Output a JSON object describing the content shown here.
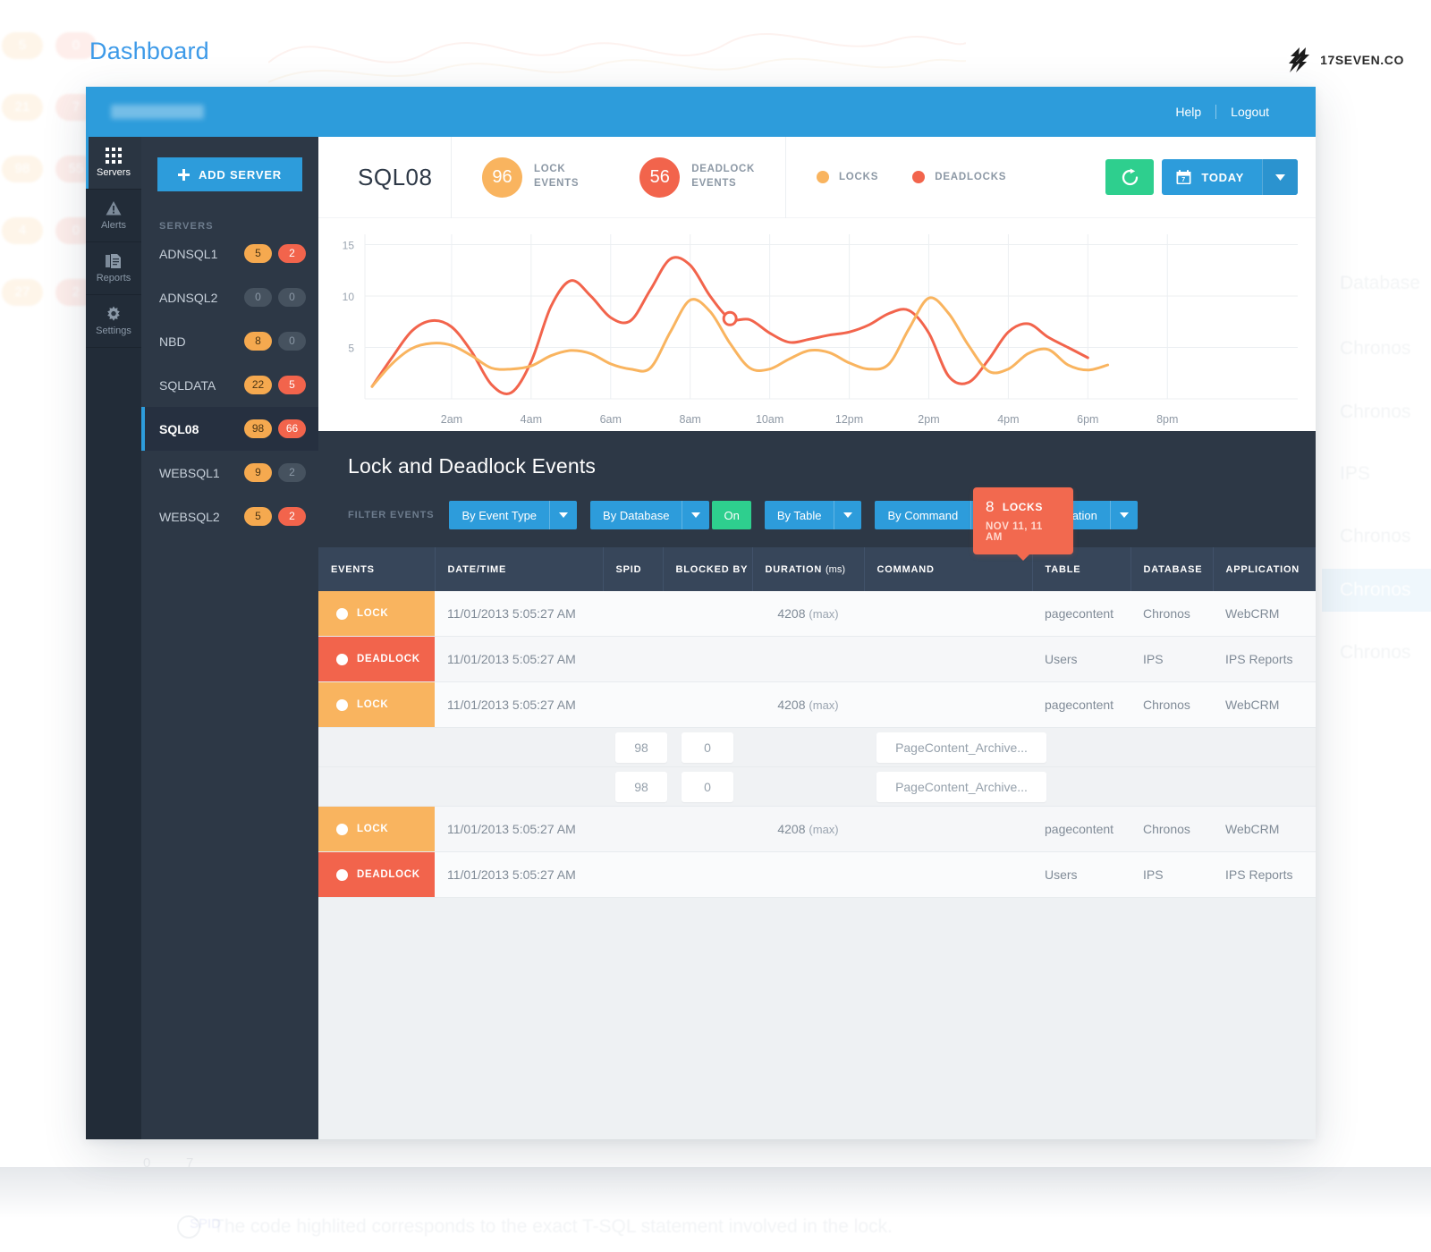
{
  "page": {
    "title": "Dashboard",
    "brand_name": "17SEVEN.CO"
  },
  "topbar": {
    "help_label": "Help",
    "logout_label": "Logout"
  },
  "rail": {
    "items": [
      {
        "label": "Servers",
        "icon": "grid-icon",
        "active": true
      },
      {
        "label": "Alerts",
        "icon": "warning-icon",
        "active": false
      },
      {
        "label": "Reports",
        "icon": "document-icon",
        "active": false
      },
      {
        "label": "Settings",
        "icon": "gear-icon",
        "active": false
      }
    ]
  },
  "sidebar": {
    "add_server_label": "ADD SERVER",
    "section_heading": "SERVERS",
    "servers": [
      {
        "name": "ADNSQL1",
        "locks": "5",
        "locks_style": "amber",
        "deadlocks": "2",
        "deadlocks_style": "red",
        "active": false
      },
      {
        "name": "ADNSQL2",
        "locks": "0",
        "locks_style": "muted",
        "deadlocks": "0",
        "deadlocks_style": "muted",
        "active": false
      },
      {
        "name": "NBD",
        "locks": "8",
        "locks_style": "amber",
        "deadlocks": "0",
        "deadlocks_style": "muted",
        "active": false
      },
      {
        "name": "SQLDATA",
        "locks": "22",
        "locks_style": "amber",
        "deadlocks": "5",
        "deadlocks_style": "red",
        "active": false
      },
      {
        "name": "SQL08",
        "locks": "98",
        "locks_style": "amber",
        "deadlocks": "66",
        "deadlocks_style": "red",
        "active": true
      },
      {
        "name": "WEBSQL1",
        "locks": "9",
        "locks_style": "amber",
        "deadlocks": "2",
        "deadlocks_style": "muted",
        "active": false
      },
      {
        "name": "WEBSQL2",
        "locks": "5",
        "locks_style": "amber",
        "deadlocks": "2",
        "deadlocks_style": "red",
        "active": false
      }
    ]
  },
  "header": {
    "server_name": "SQL08",
    "metrics": [
      {
        "value": "96",
        "label_line1": "LOCK",
        "label_line2": "EVENTS",
        "color": "#f9b45f"
      },
      {
        "value": "56",
        "label_line1": "DEADLOCK",
        "label_line2": "EVENTS",
        "color": "#f2644c"
      }
    ],
    "legend": [
      {
        "label": "LOCKS",
        "color": "#f9b45f"
      },
      {
        "label": "DEADLOCKS",
        "color": "#f2644c"
      }
    ],
    "refresh_icon": "refresh-icon",
    "date_icon": "calendar-icon",
    "date_label": "TODAY"
  },
  "chart_data": {
    "type": "line",
    "title": "",
    "xlabel": "",
    "ylabel": "",
    "ylim": [
      0,
      16
    ],
    "yticks": [
      5,
      10,
      15
    ],
    "grid": true,
    "legend_position": "header",
    "xticks": [
      "2am",
      "4am",
      "6am",
      "8am",
      "10am",
      "12pm",
      "2pm",
      "4pm",
      "6pm",
      "8pm"
    ],
    "x_hours": [
      0,
      0.5,
      1,
      1.5,
      2,
      2.5,
      3,
      3.5,
      4,
      4.5,
      5,
      5.5,
      6,
      6.5,
      7,
      7.5,
      8,
      8.5,
      9,
      9.5,
      10,
      10.5,
      11,
      11.5,
      12,
      12.5,
      13,
      13.5,
      14,
      14.5,
      15,
      15.5,
      16,
      16.5,
      17,
      17.5,
      18
    ],
    "series": [
      {
        "name": "DEADLOCKS",
        "color": "#f2644c",
        "values": [
          1.2,
          4.0,
          6.6,
          7.6,
          7.0,
          4.6,
          1.4,
          0.6,
          3.6,
          9.0,
          11.5,
          10.0,
          7.9,
          7.6,
          10.6,
          13.6,
          13.0,
          10.0,
          7.8,
          7.7,
          6.4,
          5.5,
          5.8,
          6.2,
          6.5,
          7.2,
          8.3,
          8.6,
          6.4,
          2.2,
          1.6,
          3.8,
          6.5,
          7.3,
          6.0,
          5.0,
          4.0
        ]
      },
      {
        "name": "LOCKS",
        "color": "#f9b45f",
        "values": [
          1.2,
          3.4,
          4.9,
          5.4,
          5.2,
          4.2,
          3.0,
          2.9,
          3.2,
          4.2,
          4.7,
          4.4,
          3.4,
          2.9,
          3.0,
          6.5,
          9.6,
          8.5,
          5.4,
          3.0,
          2.9,
          3.9,
          4.7,
          4.5,
          3.5,
          2.9,
          3.4,
          6.8,
          9.8,
          8.3,
          5.2,
          2.7,
          2.9,
          4.4,
          4.8,
          3.3,
          2.8,
          3.3
        ]
      }
    ],
    "tooltip": {
      "value": "8",
      "unit": "LOCKS",
      "timestamp": "NOV 11, 11 AM"
    }
  },
  "events": {
    "title": "Lock and Deadlock Events",
    "filter_label": "FILTER EVENTS",
    "filters": [
      {
        "label": "By Event Type",
        "toggle": null
      },
      {
        "label": "By Database",
        "toggle": "On"
      },
      {
        "label": "By Table",
        "toggle": null
      },
      {
        "label": "By Command",
        "toggle": null
      },
      {
        "label": "By Application",
        "toggle": null
      }
    ]
  },
  "table": {
    "columns": [
      {
        "key": "events",
        "label": "EVENTS"
      },
      {
        "key": "datetime",
        "label": "DATE/TIME"
      },
      {
        "key": "spid",
        "label": "SPID"
      },
      {
        "key": "blocked_by",
        "label": "BLOCKED BY"
      },
      {
        "key": "duration",
        "label": "DURATION (ms)",
        "label_main": "DURATION",
        "label_unit": "(ms)"
      },
      {
        "key": "command",
        "label": "COMMAND"
      },
      {
        "key": "table",
        "label": "TABLE"
      },
      {
        "key": "database",
        "label": "DATABASE"
      },
      {
        "key": "application",
        "label": "APPLICATION"
      }
    ],
    "rows": [
      {
        "kind": "event",
        "event_type": "LOCK",
        "event_style": "lock",
        "datetime": "11/01/2013  5:05:27 AM",
        "spid": "",
        "blocked_by": "",
        "duration": "4208",
        "duration_unit": "(max)",
        "command": "",
        "table": "pagecontent",
        "database": "Chronos",
        "application": "WebCRM"
      },
      {
        "kind": "event",
        "event_type": "DEADLOCK",
        "event_style": "deadlock",
        "datetime": "11/01/2013  5:05:27 AM",
        "spid": "",
        "blocked_by": "",
        "duration": "",
        "duration_unit": "",
        "command": "",
        "table": "Users",
        "database": "IPS",
        "application": "IPS Reports"
      },
      {
        "kind": "event",
        "event_type": "LOCK",
        "event_style": "lock",
        "datetime": "11/01/2013  5:05:27 AM",
        "spid": "",
        "blocked_by": "",
        "duration": "4208",
        "duration_unit": "(max)",
        "command": "",
        "table": "pagecontent",
        "database": "Chronos",
        "application": "WebCRM"
      },
      {
        "kind": "detail",
        "spid": "98",
        "blocked_by": "0",
        "command": "PageContent_Archive..."
      },
      {
        "kind": "detail",
        "spid": "98",
        "blocked_by": "0",
        "command": "PageContent_Archive..."
      },
      {
        "kind": "event",
        "event_type": "LOCK",
        "event_style": "lock",
        "datetime": "11/01/2013  5:05:27 AM",
        "spid": "",
        "blocked_by": "",
        "duration": "4208",
        "duration_unit": "(max)",
        "command": "",
        "table": "pagecontent",
        "database": "Chronos",
        "application": "WebCRM"
      },
      {
        "kind": "event",
        "event_type": "DEADLOCK",
        "event_style": "deadlock",
        "datetime": "11/01/2013  5:05:27 AM",
        "spid": "",
        "blocked_by": "",
        "duration": "",
        "duration_unit": "",
        "command": "",
        "table": "Users",
        "database": "IPS",
        "application": "IPS Reports"
      }
    ]
  },
  "background": {
    "ghost_badges_left": [
      "5",
      "0",
      "21",
      "7",
      "98",
      "55",
      "4",
      "0",
      "27",
      "2"
    ],
    "ghost_texts_right": [
      "Database",
      "Chronos",
      "Chronos",
      "IPS",
      "Chronos",
      "Chronos",
      "Chronos"
    ],
    "ghost_note": "The code highlited corresponds to the exact T-SQL statement involved in the lock.",
    "ghost_small": "SPID"
  },
  "colors": {
    "brand_blue": "#2d9cdb",
    "amber": "#f9b45f",
    "red": "#f2644c",
    "green": "#2ecf8e",
    "dark_panel": "#2d3846",
    "dark_rail": "#222c38",
    "table_header": "#37465a"
  }
}
